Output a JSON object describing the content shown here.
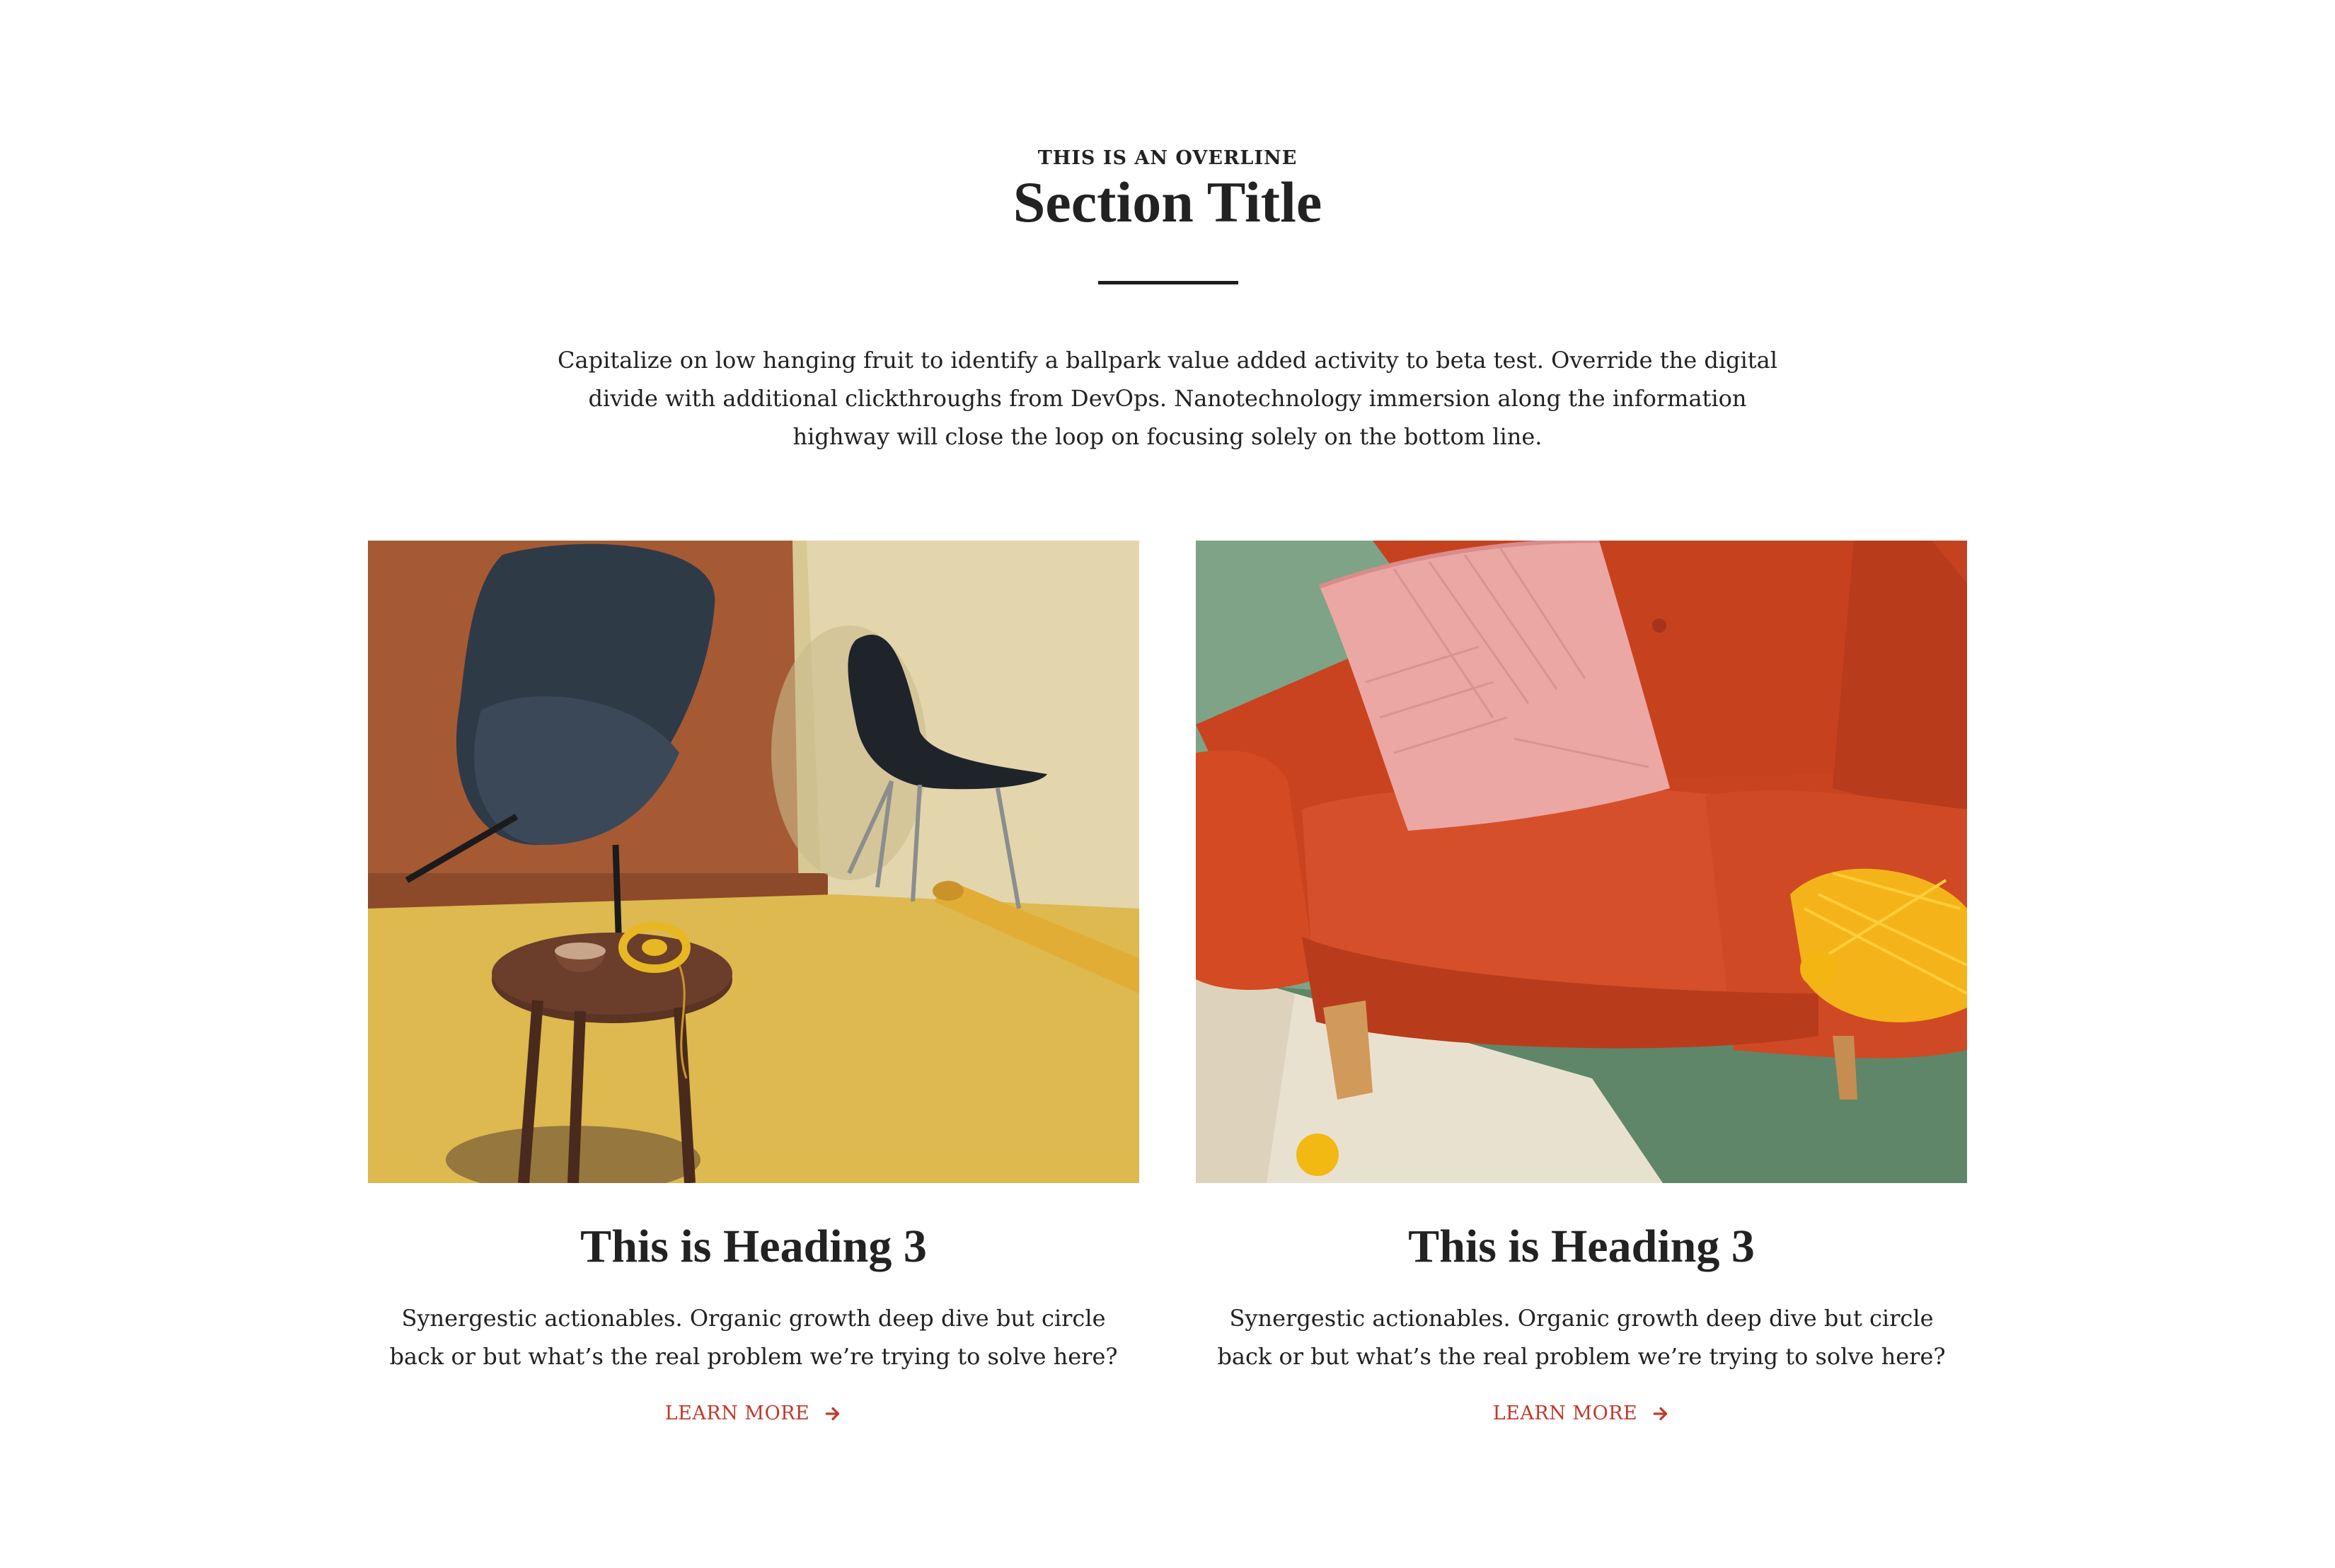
{
  "section": {
    "overline": "THIS IS AN OVERLINE",
    "title": "Section Title",
    "intro": "Capitalize on low hanging fruit to identify a ballpark value added activity to beta test. Override the digital divide with additional clickthroughs from DevOps. Nanotechnology immersion along the information highway will close the loop on focusing solely on the bottom line."
  },
  "cards": [
    {
      "heading": "This is Heading 3",
      "text": "Synergestic actionables. Organic growth deep dive but circle back or but what’s the real problem we’re trying to solve here?",
      "link_label": "LEARN MORE",
      "link_icon": "arrow-right-icon"
    },
    {
      "heading": "This is Heading 3",
      "text": "Synergestic actionables. Organic growth deep dive but circle back or but what’s the real problem we’re trying to solve here?",
      "link_label": "LEARN MORE",
      "link_icon": "arrow-right-icon"
    }
  ],
  "colors": {
    "text": "#222222",
    "link": "#c0392b",
    "divider": "#1e1e1e"
  }
}
